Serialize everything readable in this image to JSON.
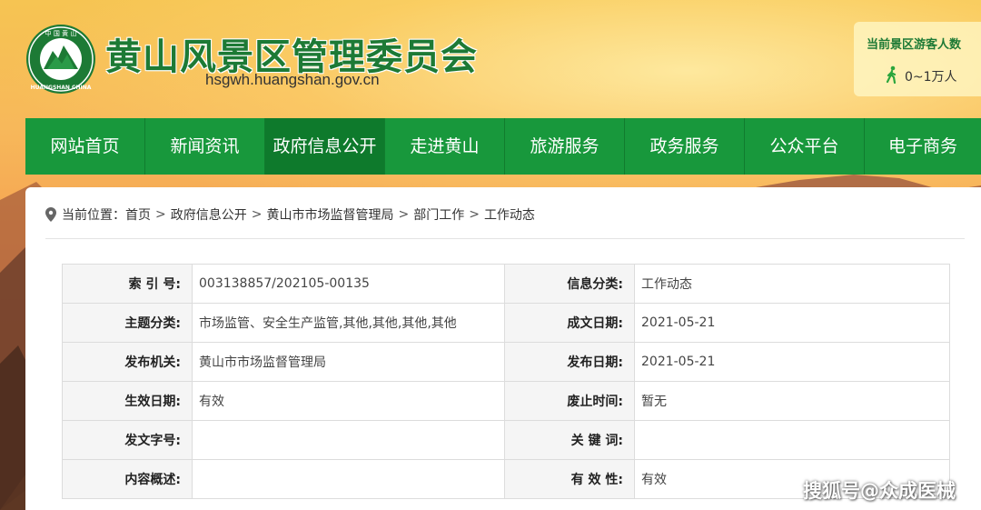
{
  "header": {
    "site_title": "黄山风景区管理委员会",
    "site_url": "hsgwh.huangshan.gov.cn",
    "logo_text_top": "中 国 黄 山",
    "logo_text_bottom": "HUANGSHAN CHINA"
  },
  "visitor": {
    "title": "当前景区游客人数",
    "count": "0~1万人",
    "icon": "walker-icon"
  },
  "nav": {
    "items": [
      {
        "label": "网站首页"
      },
      {
        "label": "新闻资讯"
      },
      {
        "label": "政府信息公开"
      },
      {
        "label": "走进黄山"
      },
      {
        "label": "旅游服务"
      },
      {
        "label": "政务服务"
      },
      {
        "label": "公众平台"
      },
      {
        "label": "电子商务"
      }
    ],
    "active_index": 2,
    "bg_color": "#18983c",
    "active_color": "#0e7a2c"
  },
  "breadcrumb": {
    "prefix": "当前位置：",
    "items": [
      "首页",
      "政府信息公开",
      "黄山市市场监督管理局",
      "部门工作",
      "工作动态"
    ],
    "separator": ">"
  },
  "info": {
    "rows": [
      {
        "l1": "索 引 号:",
        "v1": "003138857/202105-00135",
        "l2": "信息分类:",
        "v2": "工作动态"
      },
      {
        "l1": "主题分类:",
        "v1": "市场监管、安全生产监管,其他,其他,其他,其他",
        "l2": "成文日期:",
        "v2": "2021-05-21"
      },
      {
        "l1": "发布机关:",
        "v1": "黄山市市场监督管理局",
        "l2": "发布日期:",
        "v2": "2021-05-21"
      },
      {
        "l1": "生效日期:",
        "v1": "有效",
        "l2": "废止时间:",
        "v2": "暂无"
      },
      {
        "l1": "发文字号:",
        "v1": "",
        "l2": "关 键 词:",
        "v2": ""
      },
      {
        "l1": "内容概述:",
        "v1": "",
        "l2": "有 效 性:",
        "v2": "有效"
      }
    ]
  },
  "watermark": "搜狐号@众成医械"
}
